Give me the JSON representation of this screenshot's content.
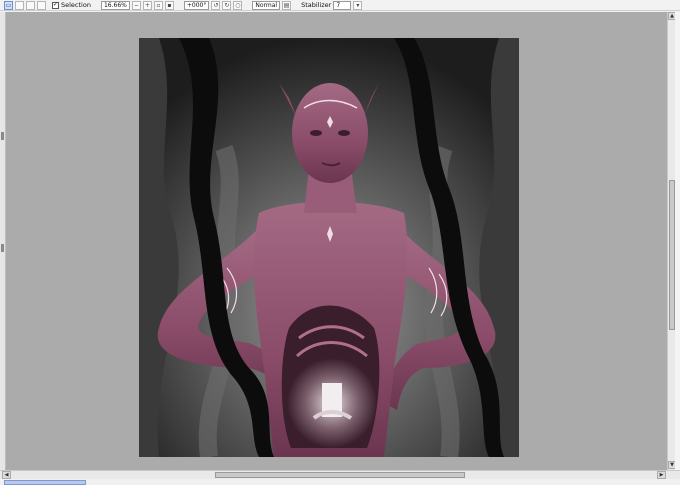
{
  "toolbar": {
    "selection_checked": true,
    "selection_label": "Selection",
    "zoom_value": "16.66%",
    "rotation_value": "+000°",
    "blend_mode": "Normal",
    "stabilizer_label": "Stabilizer",
    "stabilizer_value": "7"
  },
  "icons": {
    "check": "✓",
    "arrow_up": "▲",
    "arrow_down": "▼",
    "arrow_left": "◀",
    "arrow_right": "▶"
  },
  "colors": {
    "canvas_bg": "#ababab",
    "skin": "#8c4f6b",
    "dark": "#101010"
  }
}
